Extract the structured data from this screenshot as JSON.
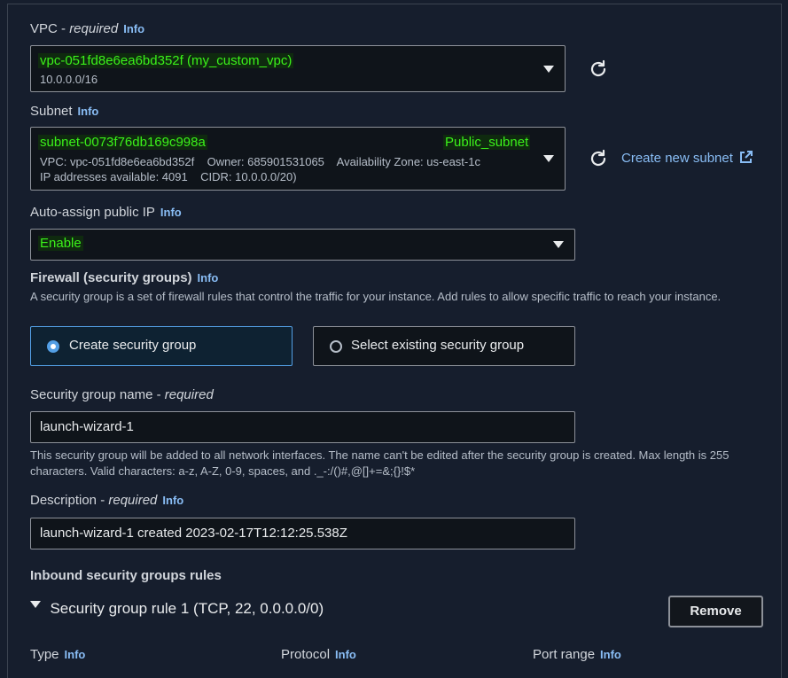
{
  "vpc": {
    "label": "VPC - ",
    "required": "required",
    "info": "Info",
    "value": "vpc-051fd8e6ea6bd352f (my_custom_vpc)",
    "cidr": "10.0.0.0/16"
  },
  "subnet": {
    "label": "Subnet",
    "info": "Info",
    "id": "subnet-0073f76db169c998a",
    "name": "Public_subnet",
    "details1": "VPC: vpc-051fd8e6ea6bd352f    Owner: 685901531065    Availability Zone: us-east-1c",
    "details2": "IP addresses available: 4091    CIDR: 10.0.0.0/20)",
    "create_link": "Create new subnet"
  },
  "auto_assign": {
    "label": "Auto-assign public IP",
    "info": "Info",
    "value": "Enable"
  },
  "firewall": {
    "label": "Firewall (security groups)",
    "info": "Info",
    "description": "A security group is a set of firewall rules that control the traffic for your instance. Add rules to allow specific traffic to reach your instance.",
    "options": [
      {
        "label": "Create security group",
        "selected": true
      },
      {
        "label": "Select existing security group",
        "selected": false
      }
    ]
  },
  "sg_name": {
    "label": "Security group name - ",
    "required": "required",
    "value": "launch-wizard-1",
    "help": "This security group will be added to all network interfaces. The name can't be edited after the security group is created. Max length is 255 characters. Valid characters: a-z, A-Z, 0-9, spaces, and ._-:/()#,@[]+=&;{}!$*"
  },
  "description": {
    "label": "Description - ",
    "required": "required",
    "info": "Info",
    "value": "launch-wizard-1 created 2023-02-17T12:12:25.538Z"
  },
  "inbound": {
    "title": "Inbound security groups rules",
    "rule_title": "Security group rule 1 (TCP, 22, 0.0.0.0/0)",
    "remove_label": "Remove",
    "columns": [
      {
        "label": "Type",
        "info": "Info"
      },
      {
        "label": "Protocol",
        "info": "Info"
      },
      {
        "label": "Port range",
        "info": "Info"
      }
    ]
  },
  "colors": {
    "background": "#161e2d",
    "highlight_text": "#3bf21a",
    "info_link": "#89bdf5",
    "selected_border": "#539fe5"
  }
}
